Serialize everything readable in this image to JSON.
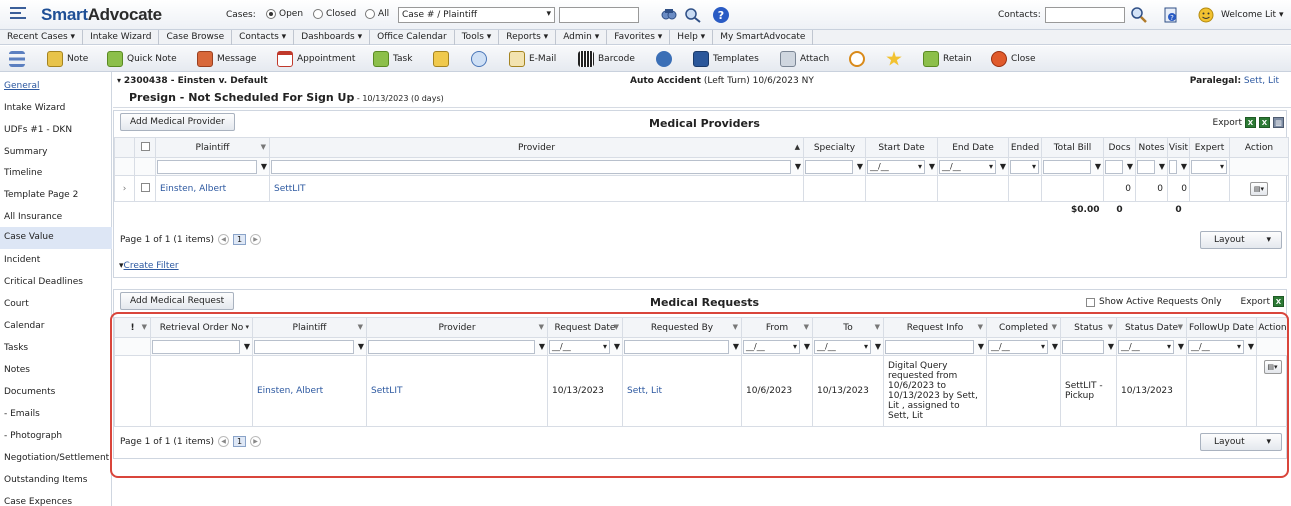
{
  "header": {
    "logo_smart": "Smart",
    "logo_advocate": "Advocate",
    "cases_label": "Cases:",
    "radio_open": "Open",
    "radio_closed": "Closed",
    "radio_all": "All",
    "case_search_select": "Case # / Plaintiff",
    "contacts_label": "Contacts:",
    "welcome": "Welcome Lit"
  },
  "menu": [
    "Recent Cases  ▾",
    "Intake Wizard",
    "Case Browse",
    "Contacts  ▾",
    "Dashboards  ▾",
    "Office Calendar",
    "Tools  ▾",
    "Reports  ▾",
    "Admin  ▾",
    "Favorites  ▾",
    "Help  ▾",
    "My SmartAdvocate"
  ],
  "toolbar": [
    "Note",
    "Quick Note",
    "Message",
    "Appointment",
    "Task",
    "E-Mail",
    "Barcode",
    "Templates",
    "Attach",
    "Retain",
    "Close"
  ],
  "sidebar": [
    "General",
    "Intake Wizard",
    "UDFs #1 - DKN",
    "Summary",
    "Timeline",
    "Template Page 2",
    "All Insurance",
    "Case Value",
    "Incident",
    "Critical Deadlines",
    "Court",
    "Calendar",
    "Tasks",
    "Notes",
    "Documents",
    " - Emails",
    " - Photograph",
    "Negotiation/Settlement",
    "Outstanding Items",
    "Case Expences"
  ],
  "case": {
    "number": "2300438 - Einsten v. Default",
    "stage": "Presign - Not Scheduled For Sign Up",
    "stage_date": " - 10/13/2023 (0 days)",
    "type": "Auto Accident",
    "type_detail": " (Left Turn) 10/6/2023 NY",
    "paralegal_label": "Paralegal:",
    "paralegal_name": " Sett, Lit"
  },
  "providers": {
    "add_button": "Add Medical Provider",
    "title": "Medical Providers",
    "export_label": "Export",
    "columns": [
      "Plaintiff",
      "Provider",
      "Specialty",
      "Start Date",
      "End Date",
      "Ended",
      "Total Bill",
      "Docs",
      "Notes",
      "Visit",
      "Expert",
      "Action"
    ],
    "date_filter": "__/__",
    "row": {
      "plaintiff": "Einsten, Albert",
      "provider": "SettLIT",
      "docs": "0",
      "notes": "0",
      "visit": "0"
    },
    "totals": {
      "total_bill": "$0.00",
      "docs": "0",
      "visit": "0"
    },
    "pager_text": "Page 1 of 1 (1 items)",
    "page_number": "1",
    "layout_button": "Layout",
    "create_filter": "Create Filter"
  },
  "requests": {
    "add_button": "Add Medical Request",
    "title": "Medical Requests",
    "show_active": "Show Active Requests Only",
    "export_label": "Export",
    "flag_col": "!",
    "columns": [
      "Retrieval Order No",
      "Plaintiff",
      "Provider",
      "Request Date",
      "Requested By",
      "From",
      "To",
      "Request Info",
      "Completed",
      "Status",
      "Status Date",
      "FollowUp Date",
      "Action"
    ],
    "date_filter": "__/__",
    "row": {
      "plaintiff": "Einsten, Albert",
      "provider": "SettLIT",
      "request_date": "10/13/2023",
      "requested_by": "Sett, Lit",
      "from": "10/6/2023",
      "to": "10/13/2023",
      "request_info": "Digital Query requested from 10/6/2023 to 10/13/2023 by Sett, Lit , assigned to Sett, Lit",
      "status": "SettLIT - Pickup",
      "status_date": "10/13/2023"
    },
    "pager_text": "Page 1 of 1 (1 items)",
    "page_number": "1",
    "layout_button": "Layout"
  },
  "colors": {
    "brand_blue": "#1f4f96",
    "link_blue": "#2c58a0",
    "highlight_red": "#d9453b",
    "excel_green": "#2d7a35"
  }
}
